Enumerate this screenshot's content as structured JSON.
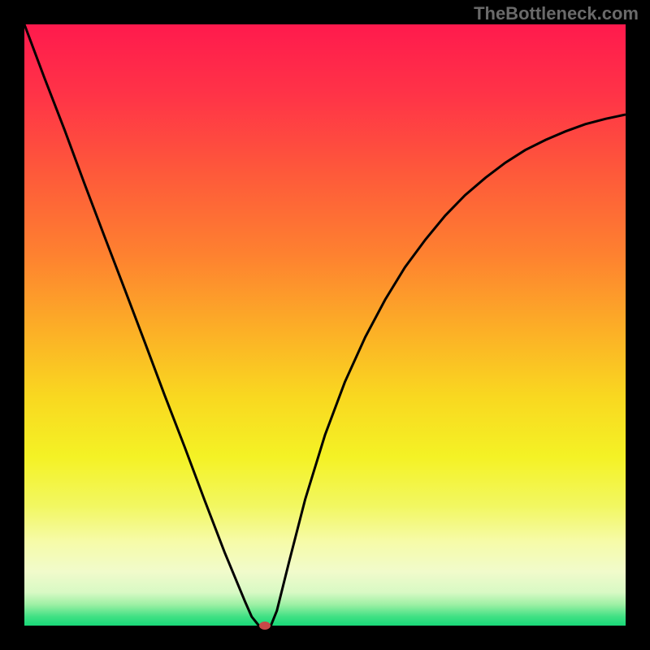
{
  "watermark": "TheBottleneck.com",
  "chart_data": {
    "type": "line",
    "title": "",
    "xlabel": "",
    "ylabel": "",
    "xlim": [
      0,
      100
    ],
    "ylim": [
      0,
      100
    ],
    "grid": false,
    "legend": false,
    "gradient_stops": [
      {
        "offset": 0.0,
        "color": "#ff1a4d"
      },
      {
        "offset": 0.12,
        "color": "#ff3447"
      },
      {
        "offset": 0.25,
        "color": "#fe5a3a"
      },
      {
        "offset": 0.38,
        "color": "#fe8030"
      },
      {
        "offset": 0.5,
        "color": "#fcac27"
      },
      {
        "offset": 0.62,
        "color": "#f9d820"
      },
      {
        "offset": 0.72,
        "color": "#f4f225"
      },
      {
        "offset": 0.8,
        "color": "#f2f760"
      },
      {
        "offset": 0.86,
        "color": "#f6fba8"
      },
      {
        "offset": 0.91,
        "color": "#f1fbcb"
      },
      {
        "offset": 0.945,
        "color": "#d8f9c4"
      },
      {
        "offset": 0.965,
        "color": "#9df0a4"
      },
      {
        "offset": 0.985,
        "color": "#40e184"
      },
      {
        "offset": 1.0,
        "color": "#18d878"
      }
    ],
    "series": [
      {
        "name": "bottleneck-curve",
        "color": "#000000",
        "x": [
          0.0,
          3.3,
          6.7,
          10.0,
          13.3,
          16.7,
          20.0,
          23.3,
          26.7,
          30.0,
          33.3,
          36.7,
          37.8,
          39.0,
          40.0,
          41.0,
          42.0,
          44.0,
          46.7,
          50.0,
          53.3,
          56.7,
          60.0,
          63.3,
          66.7,
          70.0,
          73.3,
          76.7,
          80.0,
          83.3,
          86.7,
          90.0,
          93.3,
          96.7,
          100.0
        ],
        "y": [
          100.0,
          91.2,
          82.4,
          73.5,
          64.8,
          55.9,
          47.2,
          38.4,
          29.6,
          20.8,
          12.2,
          4.0,
          1.5,
          0.0,
          0.0,
          0.0,
          2.5,
          10.5,
          21.0,
          31.7,
          40.5,
          48.0,
          54.2,
          59.6,
          64.2,
          68.2,
          71.6,
          74.5,
          77.0,
          79.1,
          80.8,
          82.2,
          83.4,
          84.3,
          85.0
        ]
      }
    ],
    "marker": {
      "x": 40.0,
      "y": 0.0,
      "color": "#c94848"
    }
  }
}
